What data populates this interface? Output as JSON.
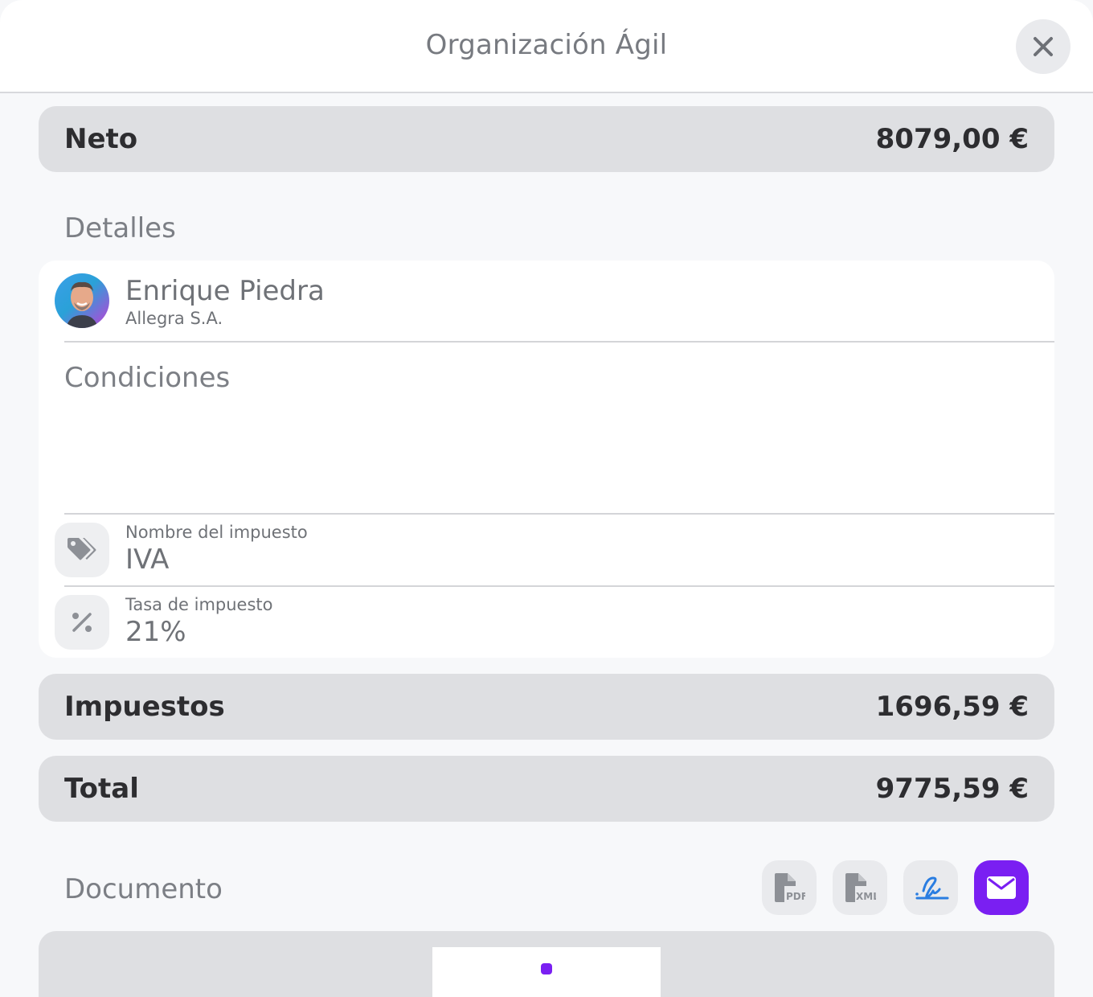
{
  "header": {
    "title": "Organización Ágil"
  },
  "summary": {
    "net": {
      "label": "Neto",
      "value": "8079,00 €"
    },
    "taxes": {
      "label": "Impuestos",
      "value": "1696,59 €"
    },
    "total": {
      "label": "Total",
      "value": "9775,59 €"
    }
  },
  "details": {
    "section_label": "Detalles",
    "contact": {
      "name": "Enrique Piedra",
      "company": "Allegra S.A."
    },
    "conditions_label": "Condiciones",
    "tax_name": {
      "label": "Nombre del impuesto",
      "value": "IVA",
      "icon": "tags-icon"
    },
    "tax_rate": {
      "label": "Tasa de impuesto",
      "value": "21%",
      "icon": "percent-icon"
    }
  },
  "document": {
    "section_label": "Documento",
    "actions": [
      {
        "name": "pdf",
        "label": "PDF",
        "icon": "file-pdf-icon"
      },
      {
        "name": "xml",
        "label": "XML",
        "icon": "file-xml-icon"
      },
      {
        "name": "signature",
        "icon": "signature-icon"
      },
      {
        "name": "email",
        "icon": "envelope-icon"
      }
    ]
  },
  "colors": {
    "accent": "#7a1ff2",
    "signature": "#2a7de1",
    "summary_bg": "#dedfe2",
    "text_muted": "#7c7f85"
  }
}
